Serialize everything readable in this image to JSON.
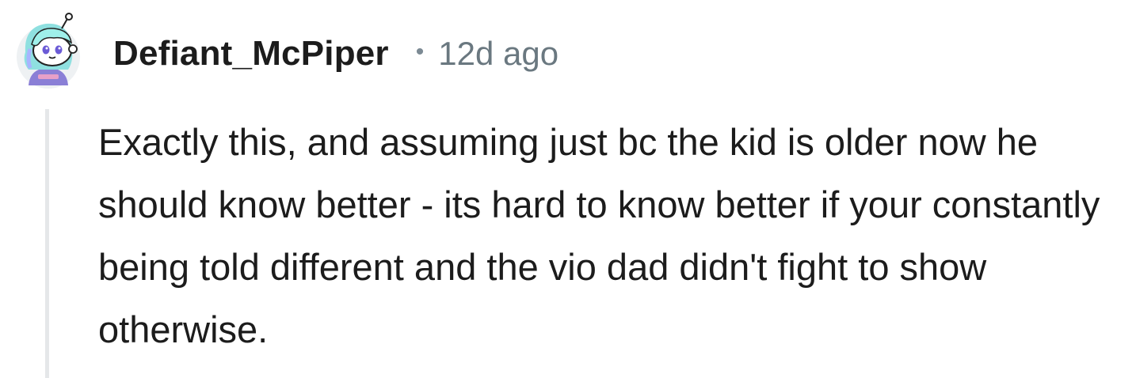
{
  "comment": {
    "author": "Defiant_McPiper",
    "separator": "•",
    "timestamp": "12d ago",
    "avatar_icon": "snoo-avatar-icon",
    "body": "Exactly this, and assuming just bc the kid is older now he should know better - its hard to know better if your constantly being told different and the vio dad didn't fight to show otherwise."
  },
  "colors": {
    "username": "#1c1c1c",
    "timestamp": "#6a7880",
    "thread_line": "#e5e7e9",
    "background": "#ffffff"
  }
}
